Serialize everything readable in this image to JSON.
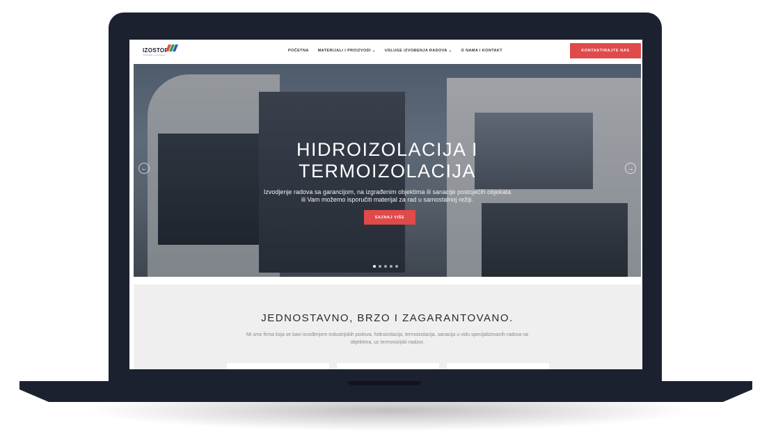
{
  "colors": {
    "accent": "#e04a4a",
    "device": "#1c2130",
    "section_bg": "#efefef"
  },
  "logo": {
    "text": "IZOSTOP",
    "subtitle": "hidroizolacija · termoizolacija"
  },
  "nav": {
    "items": [
      {
        "label": "Početna",
        "caret": false
      },
      {
        "label": "Materijali i proizvodi",
        "caret": true
      },
      {
        "label": "Usluge izvođenja radova",
        "caret": true
      },
      {
        "label": "O nama i kontakt",
        "caret": false
      }
    ],
    "cta_label": "Kontaktirajte nas"
  },
  "hero": {
    "title_line1": "HIDROIZOLACIJA I",
    "title_line2": "TERMOIZOLACIJA",
    "subtitle_line1": "Izvodjenje radova sa garancijom, na izgrađenim objektima ili sanacije postojećih objekata",
    "subtitle_line2": "ili Vam možemo isporučiti materijal za rad u samostalnoj režiji.",
    "button_label": "Saznaj više",
    "prev_icon": "arrow-left-icon",
    "next_icon": "arrow-right-icon",
    "slides_count": 5,
    "active_slide": 1
  },
  "section": {
    "title": "JEDNOSTAVNO, BRZO I ZAGARANTOVANO.",
    "text_line1": "Mi smo firma koja se bavi izvođenjem industrijskih podova, hidroizolacija, termoizolacija, sanacija u vidu specijalizovanih radova na",
    "text_line2": "objektima, uz termovizijski nadzor."
  }
}
